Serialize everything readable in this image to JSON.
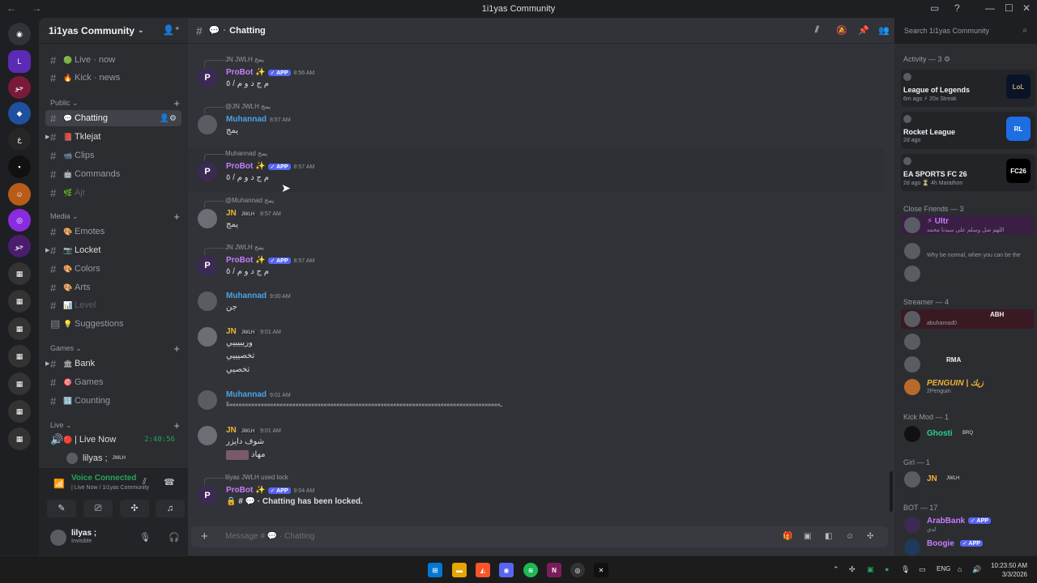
{
  "window": {
    "title": "1i1yas Community"
  },
  "server": {
    "name": "1i1yas Community"
  },
  "sidebar": {
    "top_channels": [
      {
        "label": "Live · now",
        "emoji": "🟢"
      },
      {
        "label": "Kick · news",
        "emoji": "🔥"
      }
    ],
    "categories": [
      {
        "name": "Public",
        "channels": [
          {
            "label": "Chatting",
            "emoji": "💬",
            "active": true
          },
          {
            "label": "Tklejat",
            "emoji": "📕"
          },
          {
            "label": "Clips",
            "emoji": "📹"
          },
          {
            "label": "Commands",
            "emoji": "🤖"
          },
          {
            "label": "Ajr",
            "emoji": "🌿"
          }
        ]
      },
      {
        "name": "Media",
        "channels": [
          {
            "label": "Emotes",
            "emoji": "🎨"
          },
          {
            "label": "Locket",
            "emoji": "📷"
          },
          {
            "label": "Colors",
            "emoji": "🎨"
          },
          {
            "label": "Arts",
            "emoji": "🎨"
          },
          {
            "label": "Level",
            "emoji": "📊"
          },
          {
            "label": "Suggestions",
            "emoji": "💡"
          }
        ]
      },
      {
        "name": "Games",
        "channels": [
          {
            "label": "Bank",
            "emoji": "🏛"
          },
          {
            "label": "Games",
            "emoji": "🎯"
          },
          {
            "label": "Counting",
            "emoji": "🔢"
          }
        ]
      },
      {
        "name": "Live",
        "channels": [
          {
            "label": "| Live Now",
            "emoji": "🔴",
            "timer": "2:40:56"
          }
        ]
      }
    ],
    "voice_user": "lilyas ;",
    "voice_user_tag": "JWLH"
  },
  "voice": {
    "status": "Voice Connected",
    "location": "| Live Now / 1i1yas Community"
  },
  "user": {
    "name": "lilyas ;",
    "status": "Invisible"
  },
  "channel": {
    "name": "Chatting",
    "emoji": "💬"
  },
  "search": {
    "placeholder": "Search 1i1yas Community"
  },
  "messages": [
    {
      "reply": "JN  JWLH  يمج",
      "author": "ProBot ✨",
      "app": true,
      "time": "8:56 AM",
      "text": "م ج د و م / ٥"
    },
    {
      "reply": "@JN  JWLH  يمج",
      "author": "Muhannad",
      "time": "8:57 AM",
      "text": "يمج"
    },
    {
      "reply": "Muhannad  يمج",
      "author": "ProBot ✨",
      "app": true,
      "time": "8:57 AM",
      "text": "م ج د و م / ٥"
    },
    {
      "reply": "@Muhannad  يمج",
      "author": "JN",
      "tag": "JWLH",
      "time": "8:57 AM",
      "text": "يمج"
    },
    {
      "reply": "JN  JWLH  يمج",
      "author": "ProBot ✨",
      "app": true,
      "time": "8:57 AM",
      "text": "م ج د و م / ٥"
    },
    {
      "author": "Muhannad",
      "time": "9:00 AM",
      "text": "جن"
    },
    {
      "author": "JN",
      "tag": "JWLH",
      "time": "9:01 AM",
      "text": "وريييييي",
      "text2": "تخصيييي",
      "text3": "تخصيي"
    },
    {
      "author": "Muhannad",
      "time": "9:01 AM",
      "text": "ّ«««««««««««««««««««««««««««««««««««««««««««««««««««««««««««««««««««««««««««««««««««««««ـ"
    },
    {
      "author": "JN",
      "tag": "JWLH",
      "time": "9:01 AM",
      "text": "شوف دايزر",
      "text2": "مهاد"
    },
    {
      "reply": "lilyas  JWLH  used  lock",
      "author": "ProBot ✨",
      "app": true,
      "time": "9:04 AM",
      "text": "🔒 # 💬 · Chatting  has been locked."
    }
  ],
  "composer": {
    "placeholder": "Message # 💬 · Chatting"
  },
  "members": {
    "activity_title": "Activity — 3",
    "activities": [
      {
        "game": "League of Legends",
        "meta": "6m ago  ⚡ 20x Streak",
        "icon": "LoL",
        "color": "#c8aa6e"
      },
      {
        "game": "Rocket League",
        "meta": "2d ago",
        "icon": "RL",
        "color": "#1d6ee3"
      },
      {
        "game": "EA SPORTS FC 26",
        "meta": "2d ago  ⏳ 4h Marathon",
        "icon": "FC26",
        "color": "#000000"
      }
    ],
    "groups": [
      {
        "title": "Close Friends — 3",
        "items": [
          {
            "name": "",
            "sub": "اللهم صل وسلم على سيدنا محمد"
          },
          {
            "name": "",
            "sub": "Why be normal, when you can be the"
          },
          {
            "name": "",
            "sub": ""
          }
        ]
      },
      {
        "title": "Streamer — 4",
        "items": [
          {
            "name": "",
            "sub": "abuhamad0",
            "tag": "ABH"
          },
          {
            "name": "",
            "sub": ""
          },
          {
            "name": "",
            "sub": "",
            "tag": "RMA"
          },
          {
            "name": "PENGUIN | زيك",
            "sub": "2Penguin",
            "color": "#f0b232"
          }
        ]
      },
      {
        "title": "Kick Mod — 1",
        "items": [
          {
            "name": "Ghosti",
            "sub": "",
            "tag": "BRQ",
            "color": "#23d18b"
          }
        ]
      },
      {
        "title": "Girl — 1",
        "items": [
          {
            "name": "JN",
            "sub": "",
            "tag": "JWLH",
            "color": "#f0b232"
          }
        ]
      },
      {
        "title": "BOT — 17",
        "items": [
          {
            "name": "ArabBank",
            "sub": "لدي",
            "app": true,
            "color": "#c77dff"
          },
          {
            "name": "Boogie",
            "sub": "",
            "app": true,
            "color": "#c77dff"
          }
        ]
      }
    ]
  },
  "taskbar": {
    "lang": "ENG",
    "time": "10:23:50 AM",
    "date": "3/3/2026"
  }
}
